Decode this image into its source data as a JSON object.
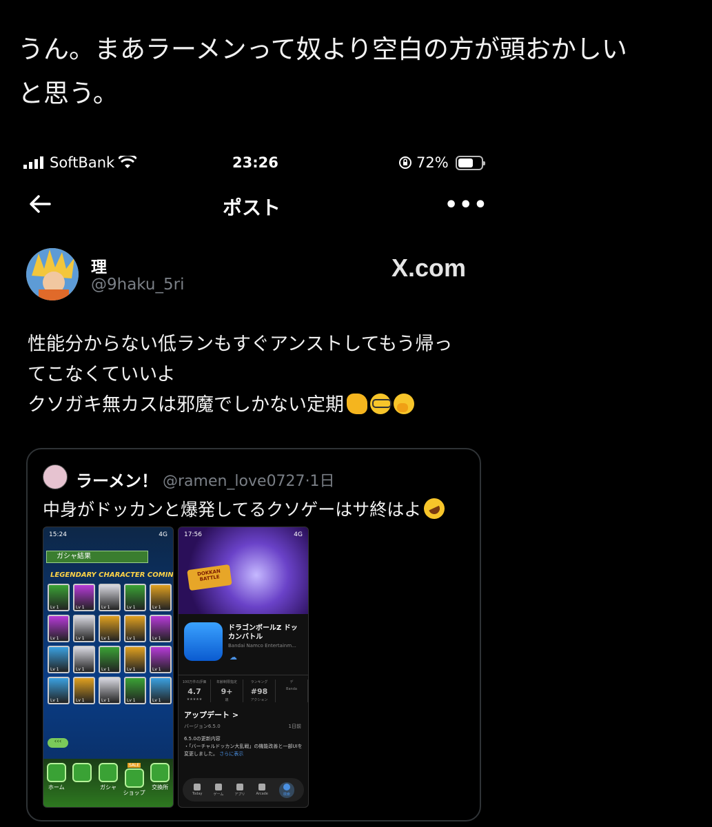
{
  "caption": [
    "うん。まあラーメンって奴より空白の方が頭おかしい",
    "と思う。"
  ],
  "status_bar": {
    "carrier": "SoftBank",
    "time": "23:26",
    "battery": "72%",
    "battery_level": 0.72
  },
  "nav": {
    "title": "ポスト"
  },
  "post": {
    "name": "理",
    "handle": "@9haku_5ri",
    "watermark": "X.com",
    "lines": [
      "性能分からない低ランもすぐアンストしてもう帰っ",
      "てこなくていいよ",
      "クソガキ無カスは邪魔でしかない定期"
    ],
    "emojis": [
      "fist-emoji",
      "nerd-face-emoji",
      "yawning-face-emoji"
    ]
  },
  "quote": {
    "name": "ラーメン！",
    "handle": "@ramen_love0727",
    "time": "·1日",
    "text": "中身がドッカンと爆発してるクソゲーはサ終はよ",
    "emoji": "rofl-emoji",
    "game_shot": {
      "time": "15:24",
      "signal": "4G",
      "banner": "ガシャ結果",
      "coming": "LEGENDARY CHARACTER COMING!",
      "card_level": "Lv 1",
      "card_colors": [
        "#3aa235",
        "#b63ad8",
        "#d8d8e0",
        "#3aa235",
        "#e0a020",
        "#b63ad8",
        "#d8d8e0",
        "#e0a020",
        "#e0a020",
        "#b63ad8",
        "#3aa0e0",
        "#d8d8e0",
        "#3aa235",
        "#e0a020",
        "#b63ad8",
        "#3aa0e0",
        "#e0a020",
        "#d8d8e0",
        "#3aa235",
        "#3aa0e0"
      ],
      "menu": [
        "ホーム",
        "",
        "ガシャ",
        "ショップ",
        "交換所"
      ],
      "sale": "SALE"
    },
    "store_shot": {
      "time": "17:56",
      "signal": "4G",
      "logo": "DOKKAN BATTLE",
      "app_name": "ドラゴンボールZ ドッカンバトル",
      "developer": "Bandai Namco Entertainm...",
      "stats": [
        {
          "label": "100万件の評価",
          "value": "4.7",
          "sub": "★★★★★"
        },
        {
          "label": "年齢制限指定",
          "value": "9+",
          "sub": "歳"
        },
        {
          "label": "ランキング",
          "value": "#98",
          "sub": "アクション"
        },
        {
          "label": "デ",
          "value": "",
          "sub": "Banda"
        }
      ],
      "update_heading": "アップデート >",
      "version": "バージョン6.5.0",
      "ago": "1日前",
      "notes": "6.5.0の更新内容\n・「バーチャルドッカン大乱戦」の機能改善と一部UIを変更しました。",
      "more": "さらに表示",
      "tabs": [
        "Today",
        "ゲーム",
        "アプリ",
        "Arcade",
        "検索"
      ]
    }
  }
}
